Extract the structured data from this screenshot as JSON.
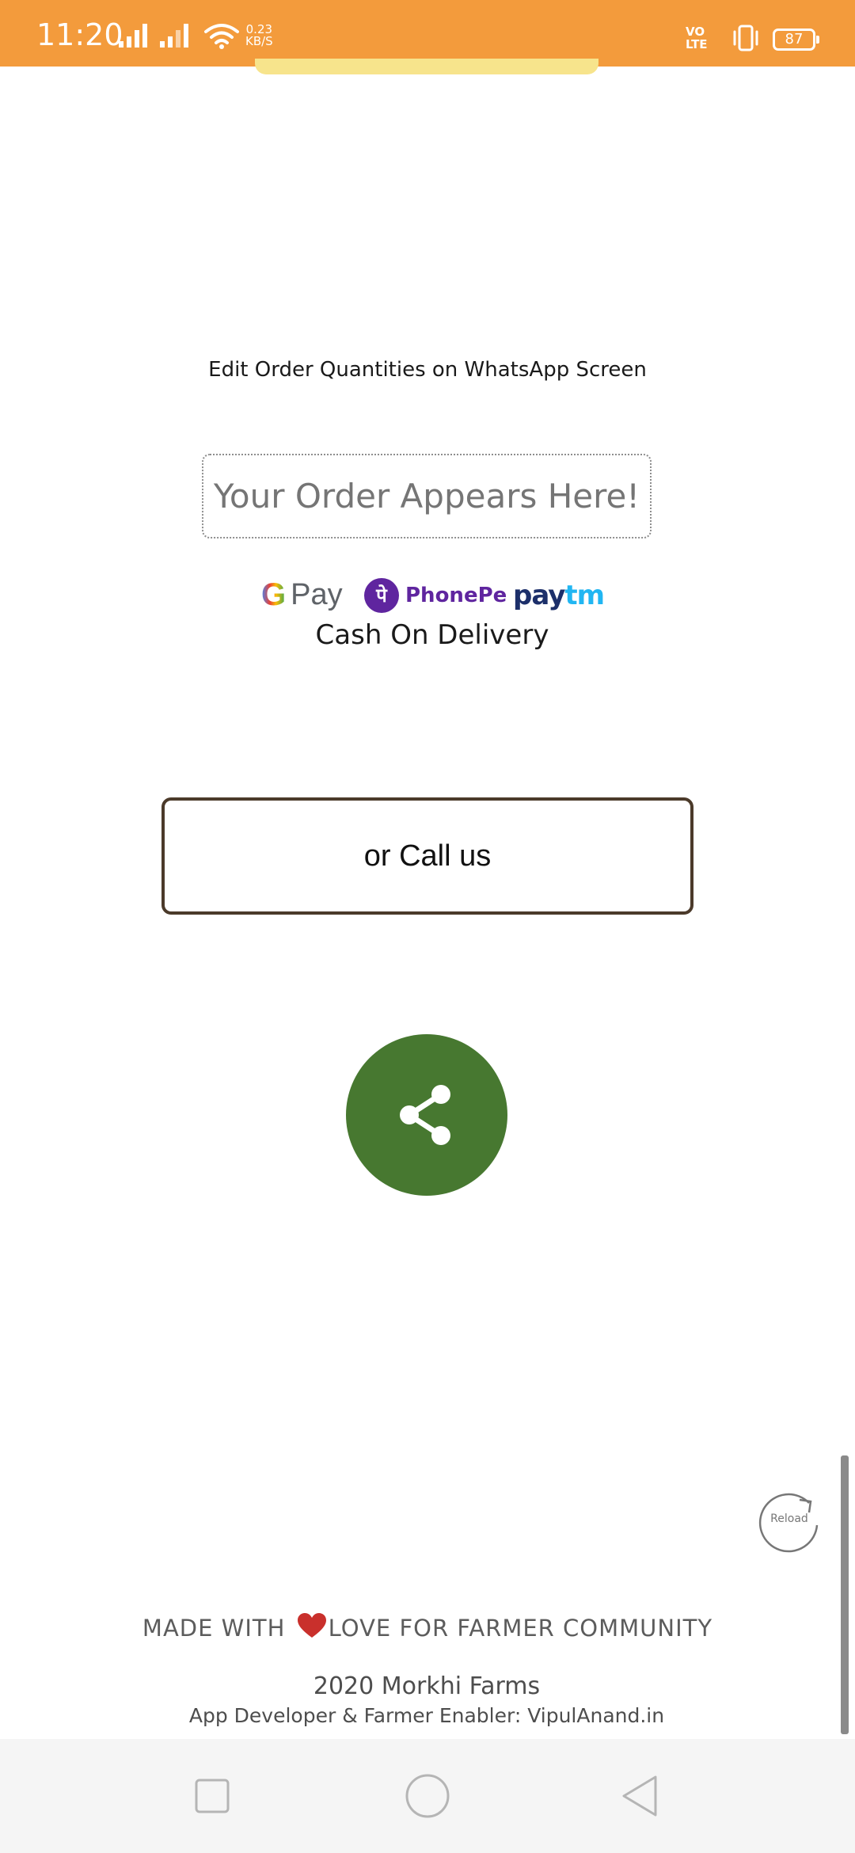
{
  "status_bar": {
    "time": "11:20",
    "net_speed_value": "0.23",
    "net_speed_unit": "KB/S",
    "volte_line1": "VO",
    "volte_line2": "LTE",
    "battery": "87",
    "icons": [
      "signal-icon",
      "signal-icon",
      "wifi-icon",
      "vibrate-icon",
      "battery-icon"
    ],
    "color": "#f39b3c"
  },
  "main": {
    "instruction": "Edit Order Quantities on WhatsApp Screen",
    "order_placeholder": "Your Order Appears Here!",
    "payments": {
      "gpay_g": "G",
      "gpay_text": "Pay",
      "phonepe_mark": "पे",
      "phonepe_text": "PhonePe",
      "paytm_pay": "pay",
      "paytm_tm": "tm"
    },
    "cod": "Cash On Delivery",
    "call_button": "or Call us",
    "share_icon": "share-icon",
    "share_color": "#477830",
    "reload_label": "Reload"
  },
  "footer": {
    "made_with_prefix": "MADE WITH",
    "made_with_suffix": "LOVE FOR FARMER COMMUNITY",
    "copyright": "2020 Morkhi Farms",
    "developer": "App Developer & Farmer Enabler: VipulAnand.in"
  },
  "nav_bar": {
    "icons": [
      "recents-square-icon",
      "home-circle-icon",
      "back-triangle-icon"
    ]
  }
}
